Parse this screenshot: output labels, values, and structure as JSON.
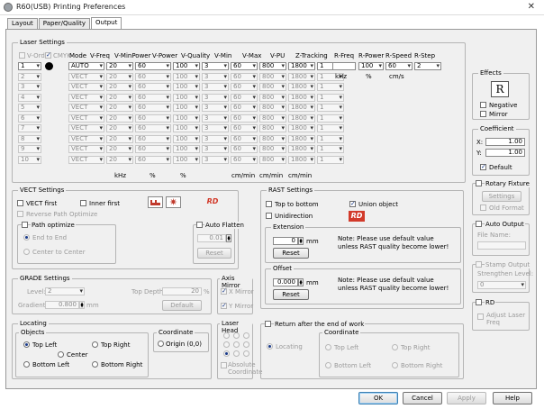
{
  "window": {
    "title": "R60(USB) Printing Preferences",
    "close": "✕"
  },
  "tabs": [
    {
      "label": "Layout"
    },
    {
      "label": "Paper/Quality"
    },
    {
      "label": "Output"
    }
  ],
  "laser": {
    "title": "Laser Settings",
    "headers": {
      "vorder": "V-Order",
      "cmyk": "CMYK",
      "mode": "Mode",
      "vfreq": "V-Freq",
      "vminpower": "V-MinPower",
      "vpower": "V-Power",
      "vquality": "V-Quality",
      "vmin": "V-Min",
      "vmax": "V-Max",
      "vpu": "V-PU",
      "ztracking": "Z-Tracking",
      "rfreq": "R-Freq",
      "rpower": "R-Power",
      "rspeed": "R-Speed",
      "rstep": "R-Step"
    },
    "rows": [
      {
        "n": "1",
        "mode": "AUTO",
        "vfreq": "20",
        "vmin": "60",
        "vpower": "100",
        "vq": "3",
        "vminv": "60",
        "vmax": "800",
        "vpu": "1800",
        "zt": "1"
      },
      {
        "n": "2",
        "mode": "VECT",
        "vfreq": "20",
        "vmin": "60",
        "vpower": "100",
        "vq": "3",
        "vminv": "60",
        "vmax": "800",
        "vpu": "1800",
        "zt": "1"
      },
      {
        "n": "3",
        "mode": "VECT",
        "vfreq": "20",
        "vmin": "60",
        "vpower": "100",
        "vq": "3",
        "vminv": "60",
        "vmax": "800",
        "vpu": "1800",
        "zt": "1"
      },
      {
        "n": "4",
        "mode": "VECT",
        "vfreq": "20",
        "vmin": "60",
        "vpower": "100",
        "vq": "3",
        "vminv": "60",
        "vmax": "800",
        "vpu": "1800",
        "zt": "1"
      },
      {
        "n": "5",
        "mode": "VECT",
        "vfreq": "20",
        "vmin": "60",
        "vpower": "100",
        "vq": "3",
        "vminv": "60",
        "vmax": "800",
        "vpu": "1800",
        "zt": "1"
      },
      {
        "n": "6",
        "mode": "VECT",
        "vfreq": "20",
        "vmin": "60",
        "vpower": "100",
        "vq": "3",
        "vminv": "60",
        "vmax": "800",
        "vpu": "1800",
        "zt": "1"
      },
      {
        "n": "7",
        "mode": "VECT",
        "vfreq": "20",
        "vmin": "60",
        "vpower": "100",
        "vq": "3",
        "vminv": "60",
        "vmax": "800",
        "vpu": "1800",
        "zt": "1"
      },
      {
        "n": "8",
        "mode": "VECT",
        "vfreq": "20",
        "vmin": "60",
        "vpower": "100",
        "vq": "3",
        "vminv": "60",
        "vmax": "800",
        "vpu": "1800",
        "zt": "1"
      },
      {
        "n": "9",
        "mode": "VECT",
        "vfreq": "20",
        "vmin": "60",
        "vpower": "100",
        "vq": "3",
        "vminv": "60",
        "vmax": "800",
        "vpu": "1800",
        "zt": "1"
      },
      {
        "n": "10",
        "mode": "VECT",
        "vfreq": "20",
        "vmin": "60",
        "vpower": "100",
        "vq": "3",
        "vminv": "60",
        "vmax": "800",
        "vpu": "1800",
        "zt": "1"
      }
    ],
    "raster": {
      "rfreq": "",
      "rpower": "100",
      "rspeed": "60",
      "rstep": "2"
    },
    "units_raster": {
      "khz": "kHz",
      "pct": "%",
      "cms": "cm/s"
    },
    "units_vector": {
      "khz": "kHz",
      "pct1": "%",
      "pct2": "%",
      "cmmin1": "cm/min",
      "cmmin2": "cm/min",
      "cmmin3": "cm/min"
    }
  },
  "effects": {
    "title": "Effects",
    "preview": "R",
    "negative": "Negative",
    "mirror": "Mirror"
  },
  "coefficient": {
    "title": "Coefficient",
    "x_label": "X:",
    "x": "1.00",
    "y_label": "Y:",
    "y": "1.00",
    "default": "Default"
  },
  "rotary": {
    "label": "Rotary Fixture",
    "settings": "Settings",
    "old_format": "Old Format"
  },
  "auto_output": {
    "label": "Auto Output",
    "file_name": "File Name:"
  },
  "stamp": {
    "label": "Stamp Output",
    "strengthen": "Strengthen Level:",
    "level": "0"
  },
  "rd": {
    "label": "RD",
    "adjust": "Adjust Laser Freq"
  },
  "vect": {
    "title": "VECT Settings",
    "vect_first": "VECT first",
    "inner_first": "Inner first",
    "reverse": "Reverse Path Optimize",
    "path_optimize": "Path optimize",
    "end_to_end": "End to End",
    "center_to_center": "Center to Center",
    "auto_flatten": "Auto Flatten",
    "flatten_value": "0.01",
    "reset": "Reset",
    "rd_icon": "RD"
  },
  "rast": {
    "title": "RAST Settings",
    "top_to_bottom": "Top to bottom",
    "union_object": "Union object",
    "unidirection": "Unidirection",
    "rd_icon": "RD",
    "extension": {
      "title": "Extension",
      "value": "0",
      "unit": "mm",
      "reset": "Reset",
      "note1": "Note: Please use default value",
      "note2": "unless RAST quality become lower!"
    },
    "offset": {
      "title": "Offset",
      "value": "0.000",
      "unit": "mm",
      "reset": "Reset",
      "note1": "Note: Please use default value",
      "note2": "unless RAST quality become lower!"
    }
  },
  "grade": {
    "title": "GRADE Settings",
    "level_label": "Level:",
    "level": "2",
    "top_depth_label": "Top Depth:",
    "top_depth": "20",
    "pct": "%",
    "gradient_label": "Gradient:",
    "gradient": "0.800",
    "mm": "mm",
    "default": "Default"
  },
  "axis_mirror": {
    "title": "Axis Mirror",
    "x": "X Mirror",
    "y": "Y Mirror"
  },
  "locating": {
    "title": "Locating",
    "objects": "Objects",
    "top_left": "Top Left",
    "top_right": "Top Right",
    "center": "Center",
    "bottom_left": "Bottom Left",
    "bottom_right": "Bottom Right",
    "coordinate": "Coordinate",
    "origin": "Origin (0,0)"
  },
  "laser_head": {
    "title": "Laser Head",
    "absolute": "Absolute Coordinate"
  },
  "return": {
    "label": "Return after the end of work",
    "locating": "Locating",
    "coordinate": "Coordinate",
    "top_left": "Top Left",
    "top_right": "Top Right",
    "bottom_left": "Bottom Left",
    "bottom_right": "Bottom Right"
  },
  "footer": {
    "ok": "OK",
    "cancel": "Cancel",
    "apply": "Apply",
    "help": "Help"
  },
  "colors": {
    "accent": "#1a3a8a",
    "rd_red": "#d23a2a"
  }
}
